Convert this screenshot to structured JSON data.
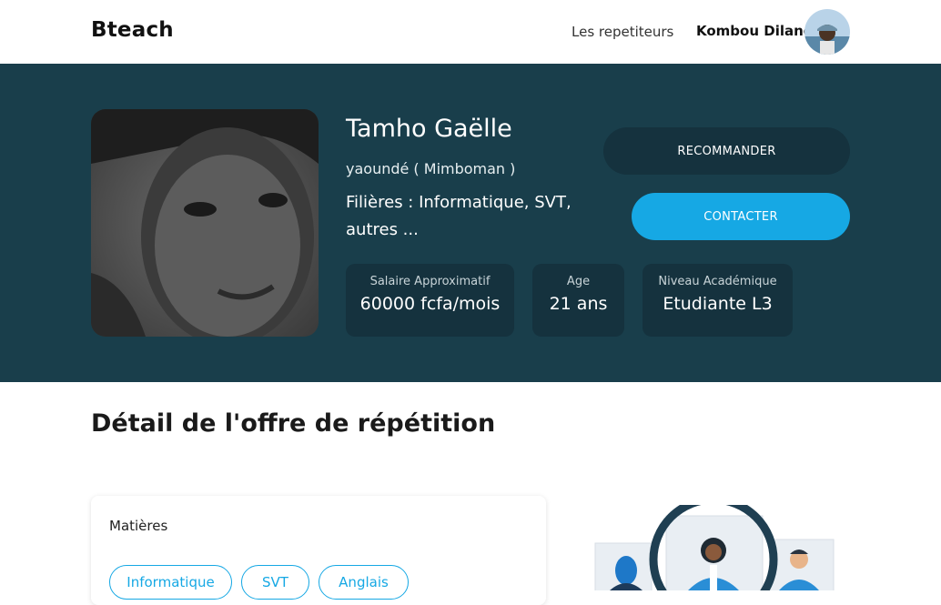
{
  "navbar": {
    "brand": "Bteach",
    "links": [
      "Les repetiteurs"
    ],
    "user_name": "Kombou Dilane"
  },
  "profile": {
    "name": "Tamho Gaëlle",
    "location": "yaoundé ( Mimboman )",
    "filieres": "Filières : Informatique, SVT, autres ...",
    "recommend_label": "RECOMMANDER",
    "contact_label": "CONTACTER",
    "stats": [
      {
        "label": "Salaire Approximatif",
        "value": "60000 fcfa/mois"
      },
      {
        "label": "Age",
        "value": "21 ans"
      },
      {
        "label": "Niveau Académique",
        "value": "Etudiante L3"
      }
    ]
  },
  "detail": {
    "title": "Détail de l'offre de répétition",
    "subjects_title": "Matières",
    "subjects": [
      "Informatique",
      "SVT",
      "Anglais"
    ]
  },
  "colors": {
    "hero_bg": "#193e4b",
    "card_dark": "#15323e",
    "accent": "#16a8e4"
  },
  "icons": {
    "avatar": "user-avatar-photo",
    "profile_photo": "profile-photo",
    "illustration": "tutors-group-illustration"
  }
}
